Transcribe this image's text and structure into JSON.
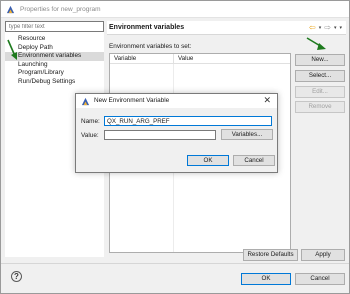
{
  "window": {
    "title": "Properties for new_program"
  },
  "sidebar": {
    "filter_placeholder": "type filter text",
    "items": [
      {
        "label": "Resource"
      },
      {
        "label": "Deploy Path"
      },
      {
        "label": "Environment variables"
      },
      {
        "label": "Launching"
      },
      {
        "label": "Program/Library"
      },
      {
        "label": "Run/Debug Settings"
      }
    ],
    "selected": "Environment variables"
  },
  "main": {
    "heading": "Environment variables",
    "section_label": "Environment variables to set:",
    "table": {
      "columns": [
        "Variable",
        "Value"
      ],
      "rows": []
    },
    "buttons": {
      "new": "New...",
      "select": "Select...",
      "edit": "Edit...",
      "remove": "Remove",
      "restore_defaults": "Restore Defaults",
      "apply": "Apply"
    }
  },
  "footer": {
    "ok": "OK",
    "cancel": "Cancel",
    "help_glyph": "?"
  },
  "dialog": {
    "title": "New Environment Variable",
    "name_label": "Name:",
    "name_value": "QX_RUN_ARG_PREF",
    "value_label": "Value:",
    "value_value": "",
    "variables_button": "Variables...",
    "ok": "OK",
    "cancel": "Cancel",
    "close_glyph": "✕"
  },
  "colors": {
    "accent": "#0078d7",
    "annotation_arrow": "#1e7a1e",
    "nav_back": "#e8a317"
  }
}
